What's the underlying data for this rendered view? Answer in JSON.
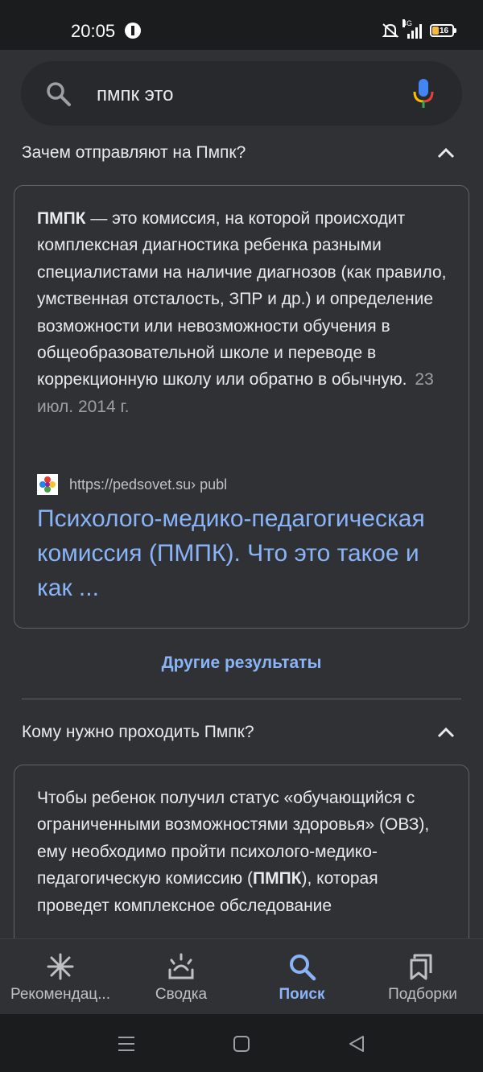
{
  "status": {
    "time": "20:05",
    "network": "4G",
    "battery": "16"
  },
  "search": {
    "query": "пмпк это"
  },
  "questions": [
    {
      "question": "Зачем отправляют на Пмпк?",
      "answer_bold": "ПМПК",
      "answer_text": " — это комиссия, на которой происходит комплексная диагностика ребенка разными специалистами на наличие диагнозов (как правило, умственная отсталость, ЗПР и др.) и определение возможности или невозможности обучения в общеобразовательной школе и переводе в коррекционную школу или обратно в обычную.",
      "date": "23 июл. 2014 г.",
      "source_url": "https://pedsovet.su",
      "source_path": " › publ",
      "result_title": "Психолого-медико-педагогическая комиссия (ПМПК). Что это такое и как ..."
    },
    {
      "question": "Кому нужно проходить Пмпк?",
      "answer_before": "Чтобы ребенок получил статус «обучающийся с ограниченными возможностями здоровья» (ОВЗ), ему необходимо пройти психолого-медико-педагогическую комиссию (",
      "answer_bold": "ПМПК",
      "answer_after": "), которая проведет комплексное обследование"
    }
  ],
  "more_results": "Другие результаты",
  "bottom_nav": [
    {
      "label": "Рекомендац...",
      "icon": "asterisk-icon",
      "active": false
    },
    {
      "label": "Сводка",
      "icon": "sunrise-icon",
      "active": false
    },
    {
      "label": "Поиск",
      "icon": "search-icon",
      "active": true
    },
    {
      "label": "Подборки",
      "icon": "collections-icon",
      "active": false
    }
  ],
  "colors": {
    "background": "#303134",
    "link": "#8ab4f8",
    "text": "#e8eaed",
    "muted": "#9aa0a6",
    "border": "#5f6368"
  }
}
